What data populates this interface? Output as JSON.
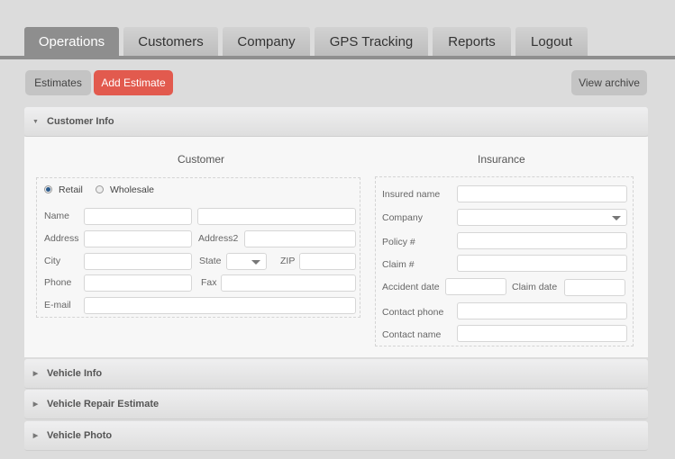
{
  "nav": {
    "tabs": [
      {
        "label": "Operations",
        "active": true
      },
      {
        "label": "Customers",
        "active": false
      },
      {
        "label": "Company",
        "active": false
      },
      {
        "label": "GPS Tracking",
        "active": false
      },
      {
        "label": "Reports",
        "active": false
      },
      {
        "label": "Logout",
        "active": false
      }
    ]
  },
  "toolbar": {
    "estimates_label": "Estimates",
    "add_estimate_label": "Add Estimate",
    "view_archive_label": "View archive",
    "accent_color": "#e25a4e"
  },
  "panels": {
    "customer_info": {
      "label": "Customer Info",
      "expanded": true
    },
    "vehicle_info": {
      "label": "Vehicle Info",
      "expanded": false
    },
    "vehicle_repair_estimate": {
      "label": "Vehicle Repair Estimate",
      "expanded": false
    },
    "vehicle_photo": {
      "label": "Vehicle Photo",
      "expanded": false
    }
  },
  "customer": {
    "title": "Customer",
    "type_options": [
      {
        "label": "Retail",
        "checked": true
      },
      {
        "label": "Wholesale",
        "checked": false
      }
    ],
    "fields": {
      "name_label": "Name",
      "first_name_value": "",
      "last_name_value": "",
      "address_label": "Address",
      "address_value": "",
      "address2_label": "Address2",
      "address2_value": "",
      "city_label": "City",
      "city_value": "",
      "state_label": "State",
      "state_value": "",
      "zip_label": "ZIP",
      "zip_value": "",
      "phone_label": "Phone",
      "phone_value": "",
      "fax_label": "Fax",
      "fax_value": "",
      "email_label": "E-mail",
      "email_value": ""
    }
  },
  "insurance": {
    "title": "Insurance",
    "fields": {
      "insured_name_label": "Insured name",
      "insured_name_value": "",
      "company_label": "Company",
      "company_value": "",
      "policy_label": "Policy #",
      "policy_value": "",
      "claim_label": "Claim #",
      "claim_value": "",
      "accident_date_label": "Accident date",
      "accident_date_value": "",
      "claim_date_label": "Claim date",
      "claim_date_value": "",
      "contact_phone_label": "Contact phone",
      "contact_phone_value": "",
      "contact_name_label": "Contact name",
      "contact_name_value": ""
    }
  }
}
